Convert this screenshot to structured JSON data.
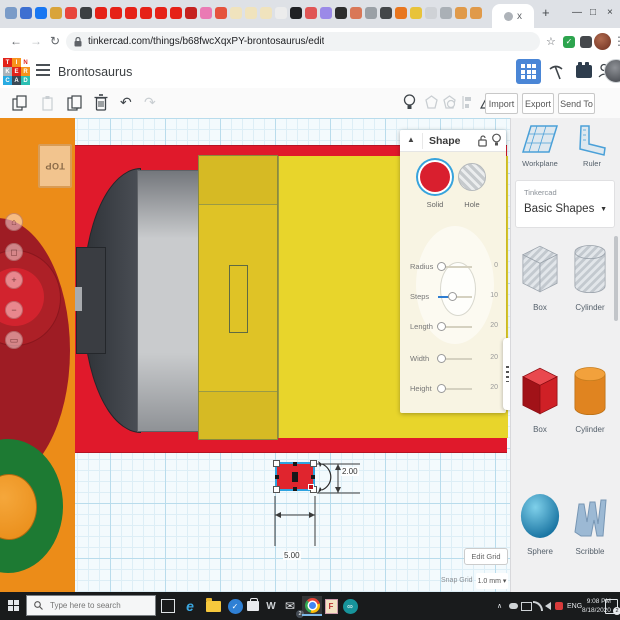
{
  "browser": {
    "tab_favicons": [
      "#7a9bc8",
      "#3d6fd1",
      "#1877f2",
      "#d9a43a",
      "#e8453c",
      "#3c4043",
      "#e62117",
      "#e62117",
      "#e62117",
      "#e62117",
      "#e62117",
      "#e62117",
      "#c5221f",
      "#ea7ab4",
      "#e5533e",
      "#f0e3bd",
      "#f0e3bd",
      "#f0e3bd",
      "#ececec",
      "#202124",
      "#e05555",
      "#9b8ae8",
      "#2d2d2d",
      "#d97757",
      "#9aa0a6",
      "#44474a",
      "#e8761f",
      "#e8c33a",
      "#cfd2d6",
      "#aab0b6",
      "#e09a4a",
      "#e09a4a"
    ],
    "active_tab_title": "x",
    "url": "tinkercad.com/things/b68fwcXqxPY-brontosaurus/edit"
  },
  "icons": {
    "back": "←",
    "forward": "→",
    "reload": "↻",
    "bookmark_star": "☆",
    "menu_dots": "⋮",
    "new_tab": "+",
    "minimize": "—",
    "maximize": "□",
    "close": "×",
    "undo": "↶",
    "redo": "↷",
    "collapse_triangle": "▲",
    "dropdown_caret": "▼",
    "small_caret": "▾",
    "home": "⌂",
    "fit_view": "◻",
    "zoom_in": "+",
    "zoom_out": "−",
    "ortho_view": "▭",
    "check": "✓",
    "edge_e": "e",
    "word_w": "W",
    "f_letter": "F",
    "infinity": "∞",
    "tray_caret": "∧",
    "mail": "✉"
  },
  "app_header": {
    "logo_tiles": [
      {
        "ch": "T",
        "bg": "#e2231a",
        "fg": "#ffffff"
      },
      {
        "ch": "I",
        "bg": "#f7941d",
        "fg": "#ffffff"
      },
      {
        "ch": "N",
        "bg": "#ffffff",
        "fg": "#e2231a"
      },
      {
        "ch": "K",
        "bg": "#aab4ba",
        "fg": "#ffffff"
      },
      {
        "ch": "E",
        "bg": "#e2231a",
        "fg": "#ffffff"
      },
      {
        "ch": "R",
        "bg": "#f7941d",
        "fg": "#ffffff"
      },
      {
        "ch": "C",
        "bg": "#29abe2",
        "fg": "#ffffff"
      },
      {
        "ch": "A",
        "bg": "#3b4a56",
        "fg": "#ffffff"
      },
      {
        "ch": "D",
        "bg": "#2bbfb3",
        "fg": "#ffffff"
      }
    ],
    "title": "Brontosaurus"
  },
  "app_toolbar": {
    "import_label": "Import",
    "export_label": "Export",
    "send_to_label": "Send To"
  },
  "shape_panel": {
    "title": "Shape",
    "solid_label": "Solid",
    "hole_label": "Hole",
    "sliders": [
      {
        "label": "Radius",
        "value": "0",
        "pos": 0,
        "active": false
      },
      {
        "label": "Steps",
        "value": "10",
        "pos": 0.42,
        "active": true
      },
      {
        "label": "Length",
        "value": "20",
        "pos": 0,
        "active": false
      },
      {
        "label": "Width",
        "value": "20",
        "pos": 0,
        "active": false
      },
      {
        "label": "Height",
        "value": "20",
        "pos": 0,
        "active": false
      }
    ]
  },
  "canvas": {
    "viewcube_label": "TOP",
    "dim_height": "2.00",
    "dim_width": "5.00",
    "edit_grid_label": "Edit Grid",
    "snap_grid_label": "Snap Grid",
    "snap_grid_value": "1.0 mm"
  },
  "shapes_sidebar": {
    "workplane_label": "Workplane",
    "ruler_label": "Ruler",
    "category_label": "Tinkercad",
    "category_value": "Basic Shapes",
    "items": [
      {
        "label": "Box",
        "variant": "box-hole"
      },
      {
        "label": "Cylinder",
        "variant": "cylinder-hole"
      },
      {
        "label": "Box",
        "variant": "box-solid"
      },
      {
        "label": "Cylinder",
        "variant": "cylinder-solid"
      },
      {
        "label": "Sphere",
        "variant": "sphere"
      },
      {
        "label": "Scribble",
        "variant": "scribble"
      }
    ]
  },
  "taskbar": {
    "search_placeholder": "Type here to search",
    "language": "ENG",
    "time": "9:08 PM",
    "date": "8/18/2020",
    "mail_badge": "2",
    "notification_badge": "2"
  }
}
